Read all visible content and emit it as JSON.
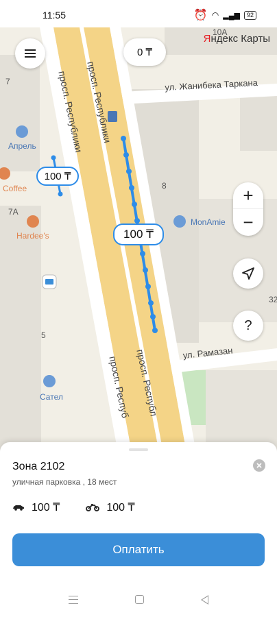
{
  "status_bar": {
    "time": "11:55",
    "battery": "92"
  },
  "map": {
    "balance": "0 ₸",
    "logo_red": "Я",
    "logo_text": "ндекс Карты",
    "streets": {
      "republic_1": "просп. Республики",
      "republic_2": "просп. Республики",
      "republic_3": "просп. Респуб",
      "republic_4": "просп. Республ",
      "zhanibek": "ул. Жанибека Таркана",
      "ramazan": "ул. Рамазан"
    },
    "pois": {
      "aprel": "Апрель",
      "coffee": "Coffee",
      "hardees": "Hardee's",
      "monamie": "MonAmie",
      "satel": "Сател"
    },
    "house_numbers": [
      "7",
      "7А",
      "8",
      "5",
      "32",
      "10А"
    ],
    "price_tags": [
      "100 ₸",
      "100 ₸"
    ],
    "controls": {
      "zoom_in": "+",
      "zoom_out": "−",
      "help": "?"
    },
    "accent_color": "#2d8ce8"
  },
  "sheet": {
    "zone_title": "Зона 2102",
    "zone_subtitle": "уличная парковка , 18 мест",
    "car_price": "100 ₸",
    "bike_price": "100 ₸",
    "pay_label": "Оплатить",
    "pay_color": "#3b8ed8"
  },
  "nav_bar": {
    "icons": [
      "menu-icon",
      "home-icon",
      "back-icon"
    ]
  }
}
